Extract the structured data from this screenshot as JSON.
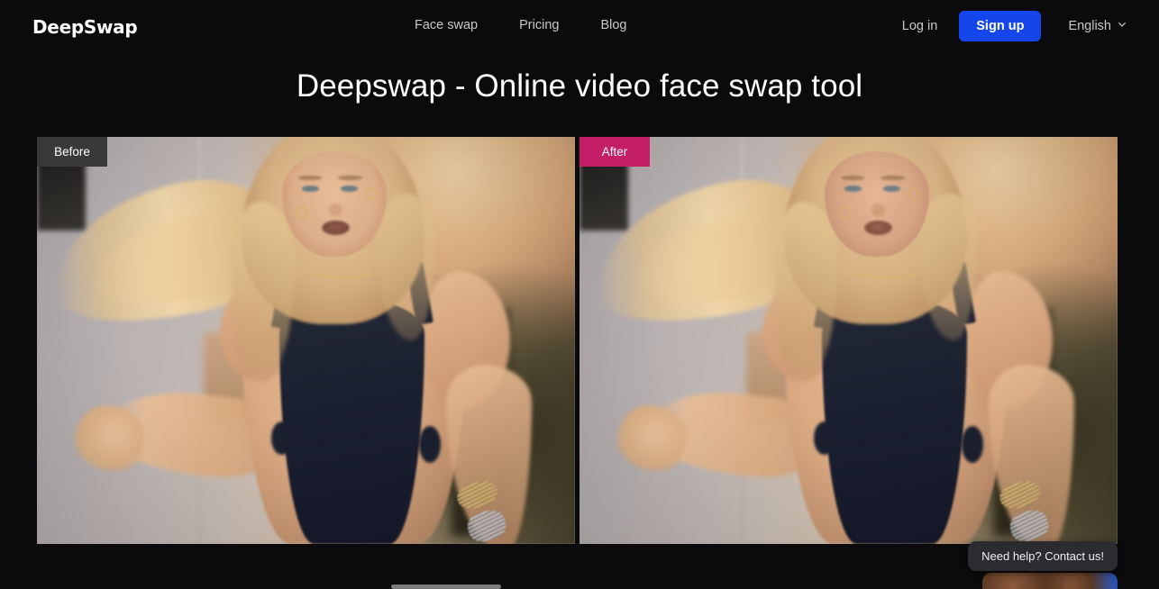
{
  "site": {
    "background_color": "#0b0b0d",
    "accent_blue": "#1546ec",
    "accent_magenta": "#c41e66",
    "badge_gray": "#39393a"
  },
  "header": {
    "logo": "DeepSwap",
    "nav": [
      {
        "label": "Face swap",
        "name": "nav-item-face-swap"
      },
      {
        "label": "Pricing",
        "name": "nav-item-pricing"
      },
      {
        "label": "Blog",
        "name": "nav-item-blog"
      }
    ],
    "login_label": "Log in",
    "signup_label": "Sign up",
    "language": "English",
    "language_chevron": "chevron-down-icon"
  },
  "hero": {
    "title": "Deepswap - Online video face swap tool"
  },
  "comparison": {
    "before": {
      "badge": "Before",
      "badge_color": "#39393a",
      "alt": "Blonde woman in dark one-piece swimsuit, hair blowing, blurred warm outdoor background"
    },
    "after": {
      "badge": "After",
      "badge_color": "#c41e66",
      "alt": "Same scene with a swapped face applied"
    }
  },
  "support": {
    "bubble_text": "Need help? Contact us!",
    "avatar_name": "support-avatar"
  }
}
